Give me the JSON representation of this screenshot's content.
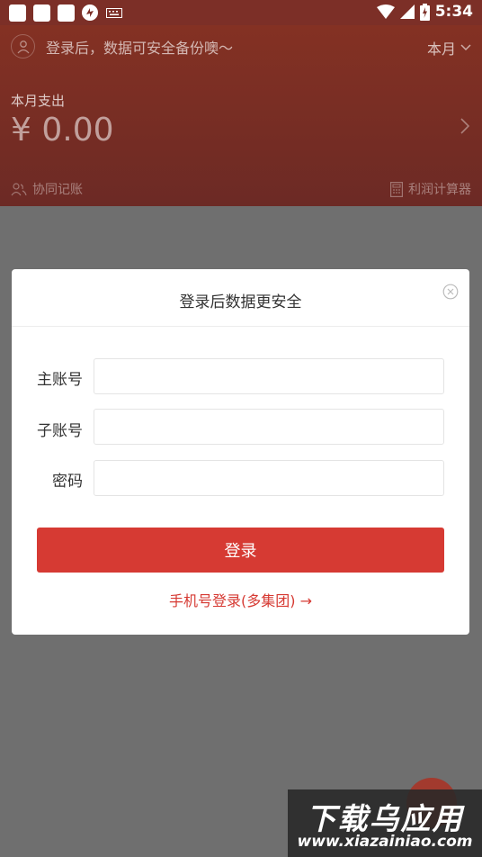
{
  "status_bar": {
    "time": "5:34"
  },
  "header": {
    "login_hint": "登录后，数据可安全备份噢～",
    "month_selector": "本月",
    "spend_label": "本月支出",
    "spend_amount": "¥ 0.00",
    "collab_label": "协同记账",
    "calculator_label": "利润计算器"
  },
  "modal": {
    "title": "登录后数据更安全",
    "fields": [
      {
        "label": "主账号",
        "value": ""
      },
      {
        "label": "子账号",
        "value": ""
      },
      {
        "label": "密码",
        "value": ""
      }
    ],
    "login_button": "登录",
    "phone_login_link": "手机号登录(多集团) →"
  },
  "watermark": {
    "title": "下载乌应用",
    "url": "www.xiazainiao.com"
  },
  "colors": {
    "header_bg": "#7c2f27",
    "accent_red": "#d63a33",
    "overlay": "#6f6f6f"
  }
}
